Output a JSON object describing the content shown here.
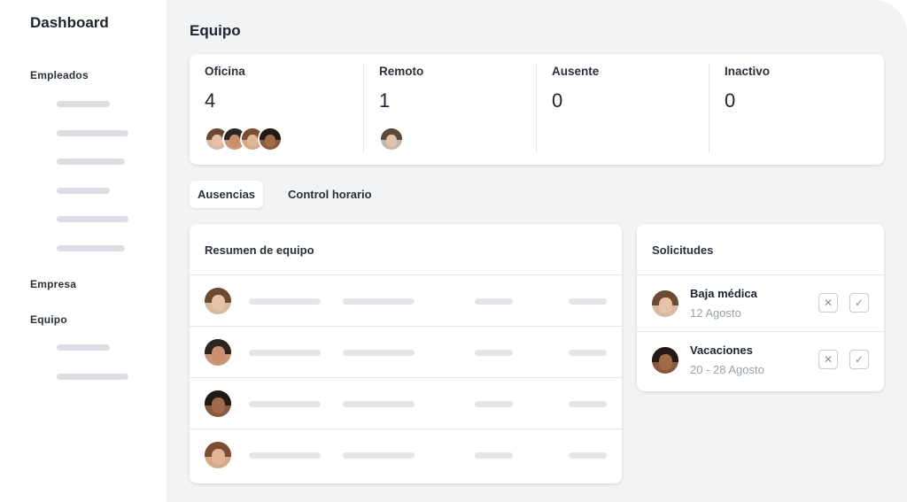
{
  "sidebar": {
    "title": "Dashboard",
    "sections": [
      {
        "label": "Empleados"
      },
      {
        "label": "Empresa"
      },
      {
        "label": "Equipo"
      }
    ]
  },
  "main": {
    "title": "Equipo",
    "stats": [
      {
        "label": "Oficina",
        "value": "4"
      },
      {
        "label": "Remoto",
        "value": "1"
      },
      {
        "label": "Ausente",
        "value": "0"
      },
      {
        "label": "Inactivo",
        "value": "0"
      }
    ],
    "tabs": [
      {
        "label": "Ausencias",
        "active": true
      },
      {
        "label": "Control horario",
        "active": false
      }
    ],
    "summary": {
      "title": "Resumen de equipo"
    },
    "requests": {
      "title": "Solicitudes",
      "items": [
        {
          "title": "Baja médica",
          "date": "12 Agosto"
        },
        {
          "title": "Vacaciones",
          "date": "20 - 28 Agosto"
        }
      ]
    }
  },
  "icons": {
    "reject": "close-icon",
    "approve": "check-icon"
  },
  "colors": {
    "background": "#f2f3f5",
    "card": "#ffffff",
    "placeholder": "#e3e5e9",
    "muted_text": "#9aa0aa"
  }
}
